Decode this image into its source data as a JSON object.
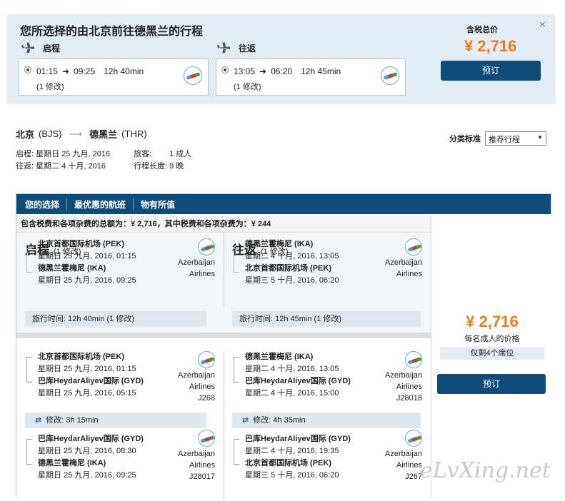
{
  "summary": {
    "title": "您所选择的由北京前往德黑兰的行程",
    "outbound_label": "启程",
    "return_label": "往返",
    "outbound": {
      "depart": "01:15",
      "arrive": "09:25",
      "duration": "12h 40min",
      "stops": "(1 修改)"
    },
    "return": {
      "depart": "13:05",
      "arrive": "06:20",
      "duration": "12h 45min",
      "stops": "(1 修改)"
    },
    "price_label": "含税总价",
    "price": "¥ 2,716",
    "book_label": "预订",
    "close": "×"
  },
  "route": {
    "from": "北京",
    "from_code": "(BJS)",
    "to": "德黑兰",
    "to_code": "(THR)"
  },
  "meta": {
    "depart_label": "启程:",
    "depart_date": "星期日 25 九月, 2016",
    "return_label": "往返:",
    "return_date": "星期二 4 十月, 2016",
    "pax_label": "旅客:",
    "pax": "1 成人",
    "length_label": "行程长度:",
    "length": "9 晚"
  },
  "sort": {
    "label": "分类标准",
    "value": "推荐行程"
  },
  "tabs": [
    "您的选择",
    "最优惠的航班",
    "物有所值"
  ],
  "total_line": "包含税费和各项杂费的总额为：¥ 2,716，其中税费和各项杂费为：¥ 244",
  "result": {
    "outbound_title": "启程",
    "outbound_sub": "(1 修改)",
    "return_title": "往返",
    "return_sub": "(1 修改)",
    "outbound_summary": {
      "from": "北京首都国际机场 (PEK)",
      "from_time": "星期日 25 九月, 2016, 01:15",
      "to": "德黑兰霍梅尼 (IKA)",
      "to_time": "星期日 25 九月, 2016, 09:25",
      "airline": [
        "Azerbaijan",
        "Airlines"
      ],
      "duration": "旅行时间: 12h 40min (1 修改)"
    },
    "return_summary": {
      "from": "德黑兰霍梅尼 (IKA)",
      "from_time": "星期二 4 十月, 2016, 13:05",
      "to": "北京首都国际机场 (PEK)",
      "to_time": "星期三 5 十月, 2016, 06:20",
      "airline": [
        "Azerbaijan",
        "Airlines"
      ],
      "duration": "旅行时间: 12h 45min (1 修改)"
    },
    "outbound_segments": [
      {
        "from": "北京首都国际机场 (PEK)",
        "from_time": "星期日 25 九月, 2016, 01:15",
        "to": "巴库HeydarAliyev国际 (GYD)",
        "to_time": "星期日 25 九月, 2016, 05:15",
        "airline": [
          "Azerbaijan",
          "Airlines"
        ],
        "flight": "J268"
      },
      {
        "from": "巴库HeydarAliyev国际 (GYD)",
        "from_time": "星期日 25 九月, 2016, 08:30",
        "to": "德黑兰霍梅尼 (IKA)",
        "to_time": "星期日 25 九月, 2016, 09:25",
        "airline": [
          "Azerbaijan",
          "Airlines"
        ],
        "flight": "J28017"
      }
    ],
    "outbound_layover": "修改: 3h 15min",
    "return_segments": [
      {
        "from": "德黑兰霍梅尼 (IKA)",
        "from_time": "星期二 4 十月, 2016, 13:05",
        "to": "巴库HeydarAliyev国际 (GYD)",
        "to_time": "星期二 4 十月, 2016, 15:00",
        "airline": [
          "Azerbaijan",
          "Airlines"
        ],
        "flight": "J28018"
      },
      {
        "from": "巴库HeydarAliyev国际 (GYD)",
        "from_time": "星期二 4 十月, 2016, 19:35",
        "to": "北京首都国际机场 (PEK)",
        "to_time": "星期三 5 十月, 2016, 06:20",
        "airline": [
          "Azerbaijan",
          "Airlines"
        ],
        "flight": "J267"
      }
    ],
    "return_layover": "修改: 4h 35min",
    "price": "¥ 2,716",
    "price_note": "每名成人的价格",
    "seats": "仅剩4个席位",
    "book_label": "预订"
  },
  "watermark": "eLvXing.net",
  "colors": {
    "accent": "#0f4c7a",
    "price": "#f07a1c",
    "panel_bg": "#e1ecf5"
  }
}
